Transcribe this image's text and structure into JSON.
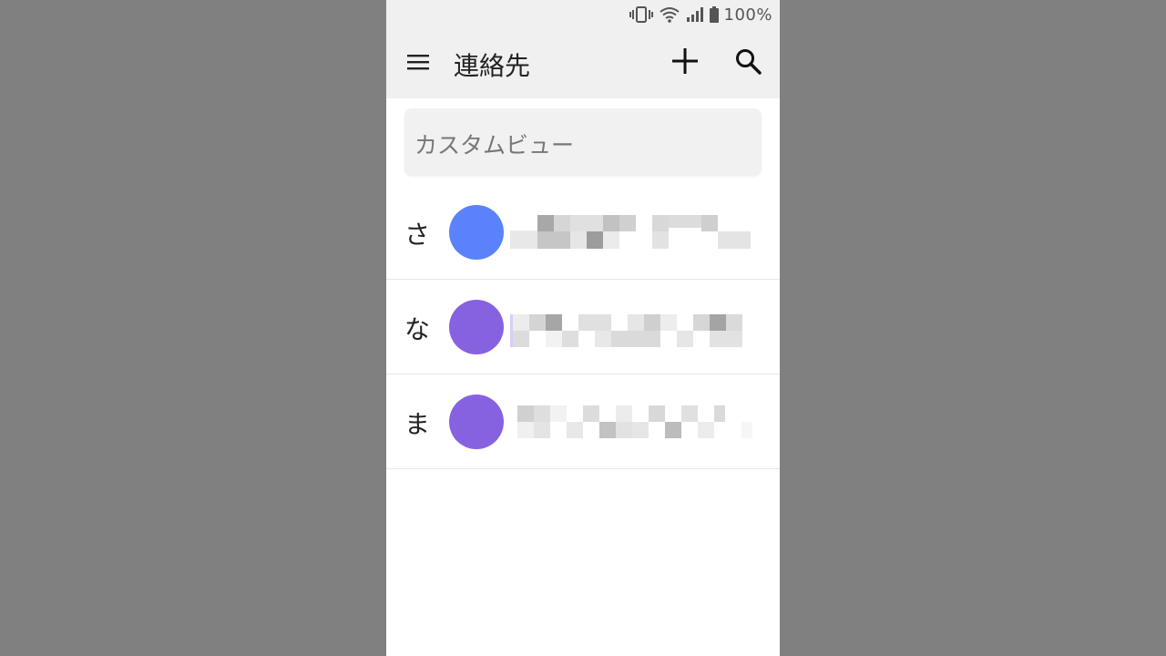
{
  "status_bar": {
    "battery_percent": "100%",
    "icons": [
      "vibrate-icon",
      "wifi-icon",
      "signal-icon",
      "battery-icon"
    ]
  },
  "app_bar": {
    "title": "連絡先",
    "icons": [
      "menu-icon",
      "add-icon",
      "search-icon"
    ]
  },
  "custom_view": {
    "label": "カスタムビュー"
  },
  "contacts": [
    {
      "index_letter": "さ",
      "avatar_color": "#5b82fb"
    },
    {
      "index_letter": "な",
      "avatar_color": "#8762e0"
    },
    {
      "index_letter": "ま",
      "avatar_color": "#8762e0"
    }
  ],
  "colors": {
    "background": "#808080",
    "app_bar": "#f0f0f0",
    "screen": "#ffffff"
  }
}
